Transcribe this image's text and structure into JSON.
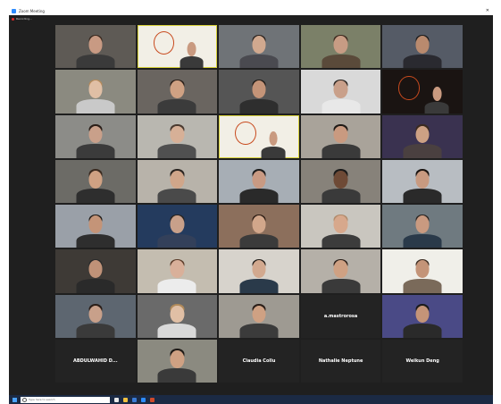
{
  "window": {
    "title": "Zoom Meeting",
    "recording_label": "Recording..."
  },
  "gallery": {
    "tiles": [
      {
        "name": "",
        "kind": "video",
        "bg": "#5e5a55",
        "skin": "#c89a83",
        "shirt": "#3a3a3a",
        "hair": "#3a2a20"
      },
      {
        "name": "",
        "kind": "logo",
        "bg": "#f2efe6"
      },
      {
        "name": "",
        "kind": "video",
        "bg": "#6f7377",
        "skin": "#d1a98f",
        "shirt": "#4a4a50",
        "hair": "#2c2420"
      },
      {
        "name": "",
        "kind": "video",
        "bg": "#7b8068",
        "skin": "#c79c84",
        "shirt": "#5a4a3a",
        "hair": "#3d2a1f"
      },
      {
        "name": "",
        "kind": "video",
        "bg": "#555b66",
        "skin": "#b98a6e",
        "shirt": "#2a2a30",
        "hair": "#1c1c1c"
      },
      {
        "name": "",
        "kind": "video",
        "bg": "#8b8a80",
        "skin": "#e0bfa5",
        "shirt": "#c9c9c9",
        "hair": "#b58a5a"
      },
      {
        "name": "",
        "kind": "video",
        "bg": "#6a6560",
        "skin": "#cfa183",
        "shirt": "#3b3b3b",
        "hair": "#2a1e18"
      },
      {
        "name": "",
        "kind": "video",
        "bg": "#555555",
        "skin": "#c49478",
        "shirt": "#2e2e2e",
        "hair": "#1f1a16"
      },
      {
        "name": "",
        "kind": "video",
        "bg": "#d9d9d9",
        "skin": "#c9a08a",
        "shirt": "#e8e8e8",
        "hair": "#2a2420"
      },
      {
        "name": "",
        "kind": "logo-dark",
        "bg": "#1a1412"
      },
      {
        "name": "",
        "kind": "video",
        "bg": "#8c8c88",
        "skin": "#c9a08a",
        "shirt": "#3b3b3b",
        "hair": "#2a1e18"
      },
      {
        "name": "",
        "kind": "video",
        "bg": "#b9b7b0",
        "skin": "#d7b097",
        "shirt": "#505050",
        "hair": "#4a3a30"
      },
      {
        "name": "",
        "kind": "logo",
        "bg": "#f2efe6"
      },
      {
        "name": "",
        "kind": "video",
        "bg": "#a9a39a",
        "skin": "#c99a80",
        "shirt": "#3a3a3a",
        "hair": "#1f1a16"
      },
      {
        "name": "",
        "kind": "video",
        "bg": "#3a3250",
        "skin": "#cda184",
        "shirt": "#4a4040",
        "hair": "#3a2a1f"
      },
      {
        "name": "",
        "kind": "video",
        "bg": "#6c6b66",
        "skin": "#cfa183",
        "shirt": "#2e2e2e",
        "hair": "#3a2a1f"
      },
      {
        "name": "",
        "kind": "video",
        "bg": "#b8b3aa",
        "skin": "#d0a68a",
        "shirt": "#4a4a4a",
        "hair": "#2a2420"
      },
      {
        "name": "",
        "kind": "video",
        "bg": "#a7aeb5",
        "skin": "#c89a83",
        "shirt": "#2a2a2a",
        "hair": "#1c1c1c"
      },
      {
        "name": "",
        "kind": "video",
        "bg": "#87827a",
        "skin": "#6e4a36",
        "shirt": "#3a3a3a",
        "hair": "#1a1a1a"
      },
      {
        "name": "",
        "kind": "video",
        "bg": "#b8bdc2",
        "skin": "#c89a80",
        "shirt": "#2a2a2a",
        "hair": "#1a1410"
      },
      {
        "name": "",
        "kind": "video",
        "bg": "#9aa0a8",
        "skin": "#c49478",
        "shirt": "#2e2e2e",
        "hair": "#1f1a16"
      },
      {
        "name": "",
        "kind": "video",
        "bg": "#243b5e",
        "skin": "#c8a08a",
        "shirt": "#33405a",
        "hair": "#2a2420"
      },
      {
        "name": "",
        "kind": "video",
        "bg": "#8c6f5c",
        "skin": "#d2a78b",
        "shirt": "#3b3b3b",
        "hair": "#2a1a12"
      },
      {
        "name": "",
        "kind": "video",
        "bg": "#c9c6bf",
        "skin": "#d7a88c",
        "shirt": "#3c3c3c",
        "hair": "#b08a6a"
      },
      {
        "name": "",
        "kind": "video",
        "bg": "#6f7a80",
        "skin": "#c99a80",
        "shirt": "#2a3a4a",
        "hair": "#2a2420"
      },
      {
        "name": "",
        "kind": "video",
        "bg": "#3e3a36",
        "skin": "#c09278",
        "shirt": "#2a2a2a",
        "hair": "#2a2a2a"
      },
      {
        "name": "",
        "kind": "video",
        "bg": "#c4bdb0",
        "skin": "#d9b09a",
        "shirt": "#ececec",
        "hair": "#5a3a28"
      },
      {
        "name": "",
        "kind": "video",
        "bg": "#d7d3cc",
        "skin": "#d2a98f",
        "shirt": "#2a3a4a",
        "hair": "#1f1a16"
      },
      {
        "name": "",
        "kind": "video",
        "bg": "#b5b0a8",
        "skin": "#cfa183",
        "shirt": "#3a3a3a",
        "hair": "#2a1e18"
      },
      {
        "name": "",
        "kind": "video",
        "bg": "#f0efe9",
        "skin": "#c49478",
        "shirt": "#7a6a5a",
        "hair": "#3a2a1f"
      },
      {
        "name": "",
        "kind": "video",
        "bg": "#5d6670",
        "skin": "#c8a08a",
        "shirt": "#3a3a3a",
        "hair": "#2a1e18"
      },
      {
        "name": "",
        "kind": "video",
        "bg": "#6a6a6a",
        "skin": "#e0bfa5",
        "shirt": "#d9d9d9",
        "hair": "#b08a5a"
      },
      {
        "name": "",
        "kind": "video",
        "bg": "#9e9a92",
        "skin": "#cfa183",
        "shirt": "#3b3b3b",
        "hair": "#2a1e18"
      },
      {
        "name": "a.mastrorosa",
        "kind": "name"
      },
      {
        "name": "",
        "kind": "video",
        "bg": "#4a4a86",
        "skin": "#c49478",
        "shirt": "#2a2a2a",
        "hair": "#1a1a1a"
      },
      {
        "name": "ABDULWAHID D...",
        "kind": "name"
      },
      {
        "name": "",
        "kind": "video",
        "bg": "#8b8a80",
        "skin": "#cfa183",
        "shirt": "#3a3a3a",
        "hair": "#1f1a16"
      },
      {
        "name": "Claudia Collu",
        "kind": "name"
      },
      {
        "name": "Nathalie Neptune",
        "kind": "name"
      },
      {
        "name": "Weikun Deng",
        "kind": "name"
      }
    ]
  },
  "taskbar": {
    "search_placeholder": "Type here to search"
  }
}
